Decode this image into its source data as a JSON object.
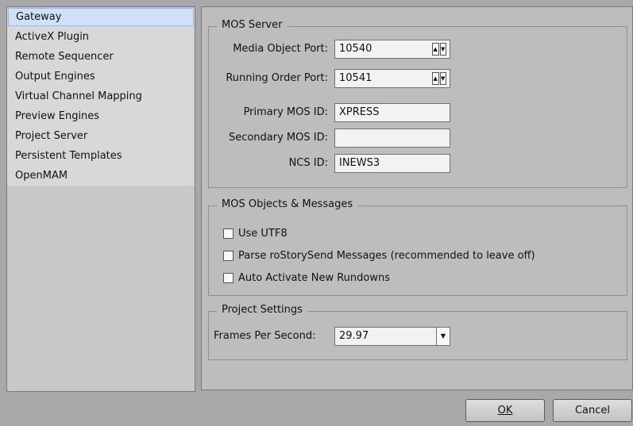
{
  "nav": {
    "items": [
      {
        "label": "Gateway",
        "selected": true
      },
      {
        "label": "ActiveX Plugin"
      },
      {
        "label": "Remote Sequencer"
      },
      {
        "label": "Output Engines"
      },
      {
        "label": "Virtual Channel Mapping"
      },
      {
        "label": "Preview Engines"
      },
      {
        "label": "Project Server"
      },
      {
        "label": "Persistent Templates"
      },
      {
        "label": "OpenMAM"
      }
    ]
  },
  "mos_server": {
    "title": "MOS Server",
    "media_object_port_label": "Media Object Port:",
    "media_object_port_value": "10540",
    "running_order_port_label": "Running Order Port:",
    "running_order_port_value": "10541",
    "primary_mos_id_label": "Primary MOS ID:",
    "primary_mos_id_value": "XPRESS",
    "secondary_mos_id_label": "Secondary MOS ID:",
    "secondary_mos_id_value": "",
    "ncs_id_label": "NCS ID:",
    "ncs_id_value": "INEWS3"
  },
  "mos_objects": {
    "title": "MOS Objects & Messages",
    "use_utf8_label": "Use UTF8",
    "parse_label": "Parse roStorySend Messages (recommended to leave off)",
    "auto_activate_label": "Auto Activate New Rundowns"
  },
  "project_settings": {
    "title": "Project Settings",
    "fps_label": "Frames Per Second:",
    "fps_value": "29.97"
  },
  "buttons": {
    "ok_label": "OK",
    "cancel_label": "Cancel"
  }
}
